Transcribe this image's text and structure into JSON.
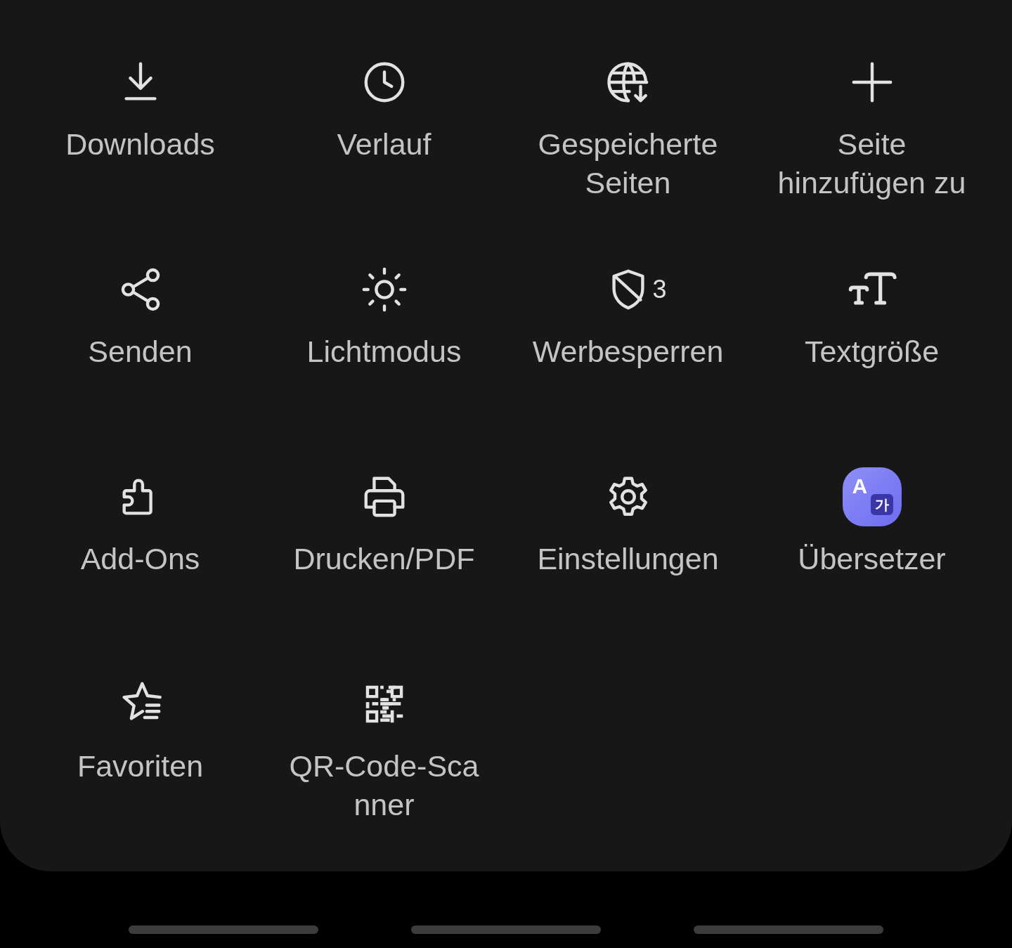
{
  "menu_items": [
    {
      "kind": "line",
      "label": "Downloads"
    },
    {
      "kind": "line",
      "label": "Verlauf"
    },
    {
      "kind": "line",
      "label": "Gespeicherte\nSeiten"
    },
    {
      "kind": "line",
      "label": "Seite\nhinzufügen zu"
    },
    {
      "kind": "line",
      "label": "Senden"
    },
    {
      "kind": "line",
      "label": "Lichtmodus"
    },
    {
      "kind": "line",
      "label": "Werbesperren",
      "badge": "3"
    },
    {
      "kind": "line",
      "label": "Textgröße"
    },
    {
      "kind": "line",
      "label": "Add-Ons"
    },
    {
      "kind": "line",
      "label": "Drucken/PDF"
    },
    {
      "kind": "line",
      "label": "Einstellungen"
    },
    {
      "kind": "app",
      "label": "Übersetzer",
      "app_letters": [
        "A",
        "가"
      ]
    },
    {
      "kind": "line",
      "label": "Favoriten"
    },
    {
      "kind": "line",
      "label": "QR-Code-Sca\nnner"
    }
  ]
}
